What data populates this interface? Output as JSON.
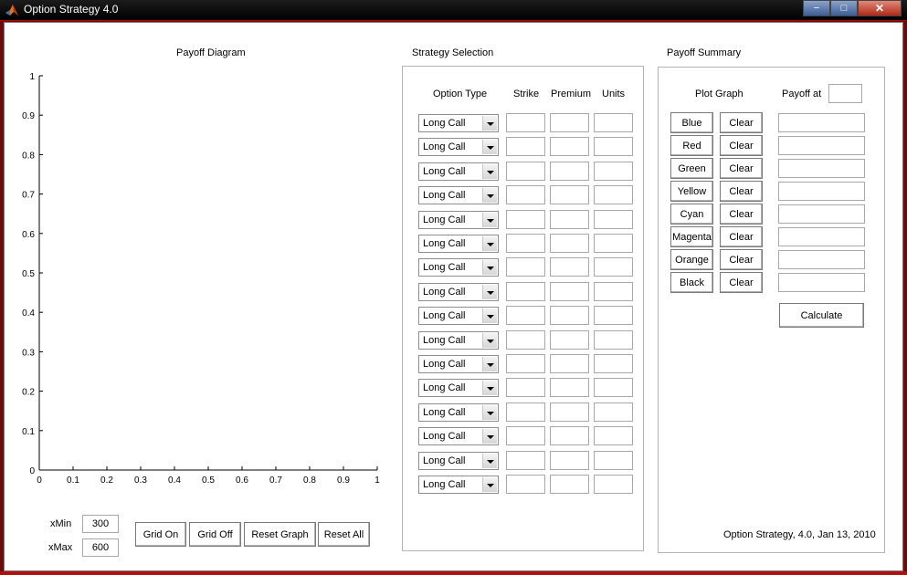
{
  "window": {
    "title": "Option Strategy 4.0",
    "controls": [
      "−",
      "□",
      "✕"
    ]
  },
  "payoff_diagram": {
    "title": "Payoff Diagram",
    "y_ticks": [
      "1",
      "0.9",
      "0.8",
      "0.7",
      "0.6",
      "0.5",
      "0.4",
      "0.3",
      "0.2",
      "0.1",
      "0"
    ],
    "x_ticks": [
      "0",
      "0.1",
      "0.2",
      "0.3",
      "0.4",
      "0.5",
      "0.6",
      "0.7",
      "0.8",
      "0.9",
      "1"
    ],
    "xmin_label": "xMin",
    "xmin_value": "300",
    "xmax_label": "xMax",
    "xmax_value": "600",
    "buttons": {
      "grid_on": "Grid On",
      "grid_off": "Grid Off",
      "reset_graph": "Reset Graph",
      "reset_all": "Reset All"
    }
  },
  "strategy_selection": {
    "title": "Strategy Selection",
    "headers": {
      "option_type": "Option Type",
      "strike": "Strike",
      "premium": "Premium",
      "units": "Units"
    },
    "rows": [
      {
        "type": "Long Call"
      },
      {
        "type": "Long Call"
      },
      {
        "type": "Long Call"
      },
      {
        "type": "Long Call"
      },
      {
        "type": "Long Call"
      },
      {
        "type": "Long Call"
      },
      {
        "type": "Long Call"
      },
      {
        "type": "Long Call"
      },
      {
        "type": "Long Call"
      },
      {
        "type": "Long Call"
      },
      {
        "type": "Long Call"
      },
      {
        "type": "Long Call"
      },
      {
        "type": "Long Call"
      },
      {
        "type": "Long Call"
      },
      {
        "type": "Long Call"
      },
      {
        "type": "Long Call"
      }
    ]
  },
  "payoff_summary": {
    "title": "Payoff Summary",
    "plot_graph_label": "Plot Graph",
    "payoff_at_label": "Payoff at",
    "colors": [
      "Blue",
      "Red",
      "Green",
      "Yellow",
      "Cyan",
      "Magenta",
      "Orange",
      "Black"
    ],
    "clear_label": "Clear",
    "calculate_label": "Calculate",
    "version_text": "Option Strategy, 4.0, Jan 13, 2010"
  }
}
